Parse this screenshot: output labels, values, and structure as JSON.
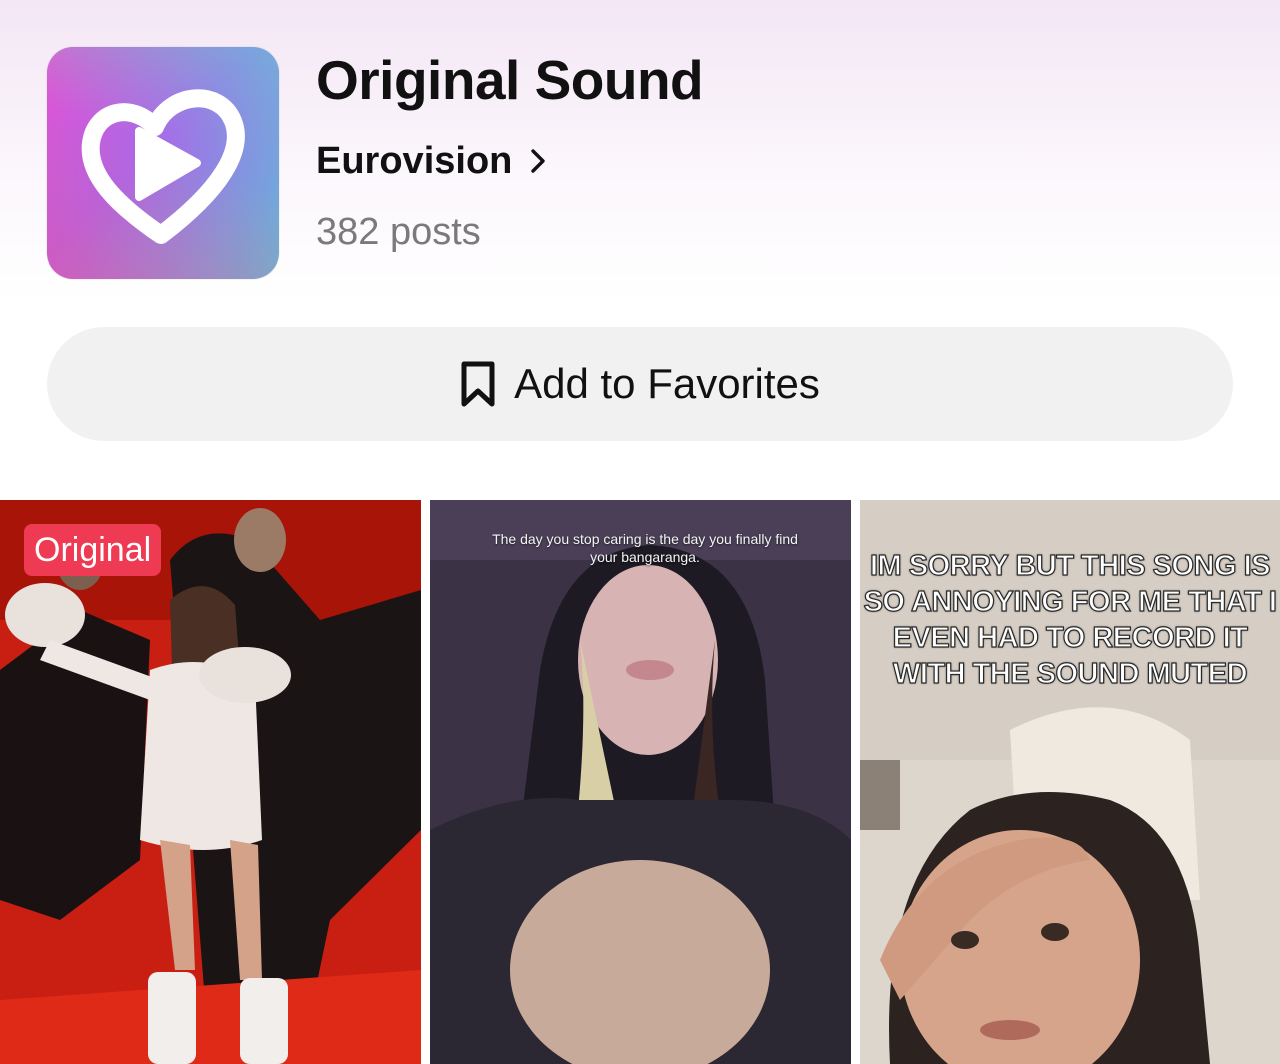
{
  "sound": {
    "title": "Original Sound",
    "artist": "Eurovision",
    "posts": "382 posts",
    "icon": "eurovision-heart-play-icon"
  },
  "favorites": {
    "label": "Add to Favorites",
    "icon": "bookmark-icon"
  },
  "videos": [
    {
      "badge": "Original",
      "caption": ""
    },
    {
      "badge": "",
      "caption": "The day you stop caring is the day you finally find your bangaranga."
    },
    {
      "badge": "",
      "caption": "IM SORRY BUT THIS SONG IS SO ANNOYING FOR ME THAT I EVEN HAD TO RECORD IT WITH THE SOUND MUTED"
    }
  ],
  "colors": {
    "badge": "#ee3a52",
    "button_bg": "#f1f1f1",
    "muted_text": "#7a7a7a"
  }
}
